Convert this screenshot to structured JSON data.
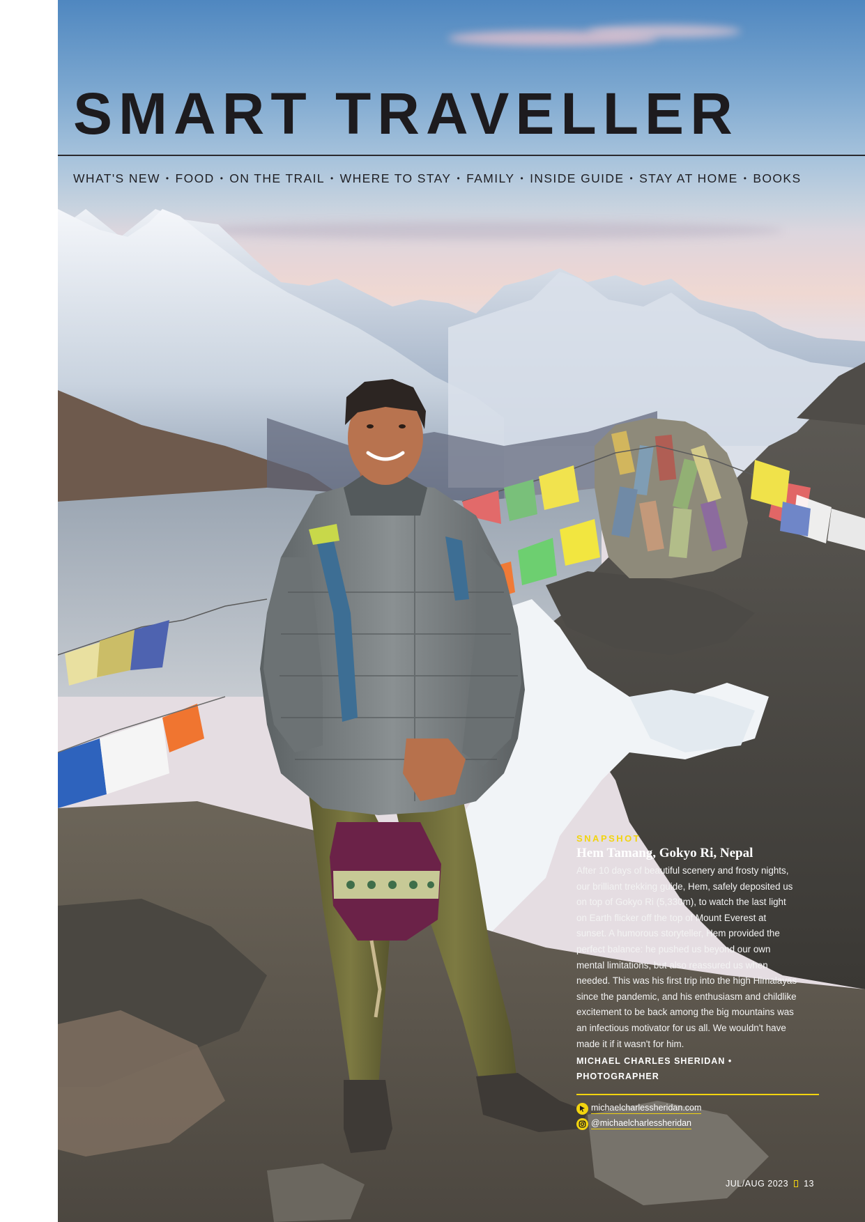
{
  "masthead": {
    "title": "SMART TRAVELLER",
    "sections": [
      "WHAT'S NEW",
      "FOOD",
      "ON THE TRAIL",
      "WHERE TO STAY",
      "FAMILY",
      "INSIDE GUIDE",
      "STAY AT HOME",
      "BOOKS"
    ],
    "separator": "•"
  },
  "caption": {
    "kicker": "SNAPSHOT",
    "headline": "Hem Tamang, Gokyo Ri, Nepal",
    "body": "After 10 days of beautiful scenery and frosty nights, our brilliant trekking guide, Hem, safely deposited us on top of Gokyo Ri (5,330m), to watch the last light on Earth flicker off the top of Mount Everest at sunset. A humorous storyteller, Hem provided the perfect balance: he pushed us beyond our own mental limitations, but also reassured us when needed. This was his first trip into the high Himalayas since the pandemic, and his enthusiasm and childlike excitement to be back among the big mountains was an infectious motivator for us all. We wouldn't have made it if it wasn't for him.",
    "credit_name": "MICHAEL CHARLES SHERIDAN •",
    "credit_role": "PHOTOGRAPHER",
    "website": "michaelcharlessheridan.com",
    "instagram": "@michaelcharlessheridan"
  },
  "folio": {
    "issue": "JUL/AUG 2023",
    "page": "13"
  },
  "colors": {
    "accent": "#f2d40f",
    "title": "#1d1b1e"
  }
}
